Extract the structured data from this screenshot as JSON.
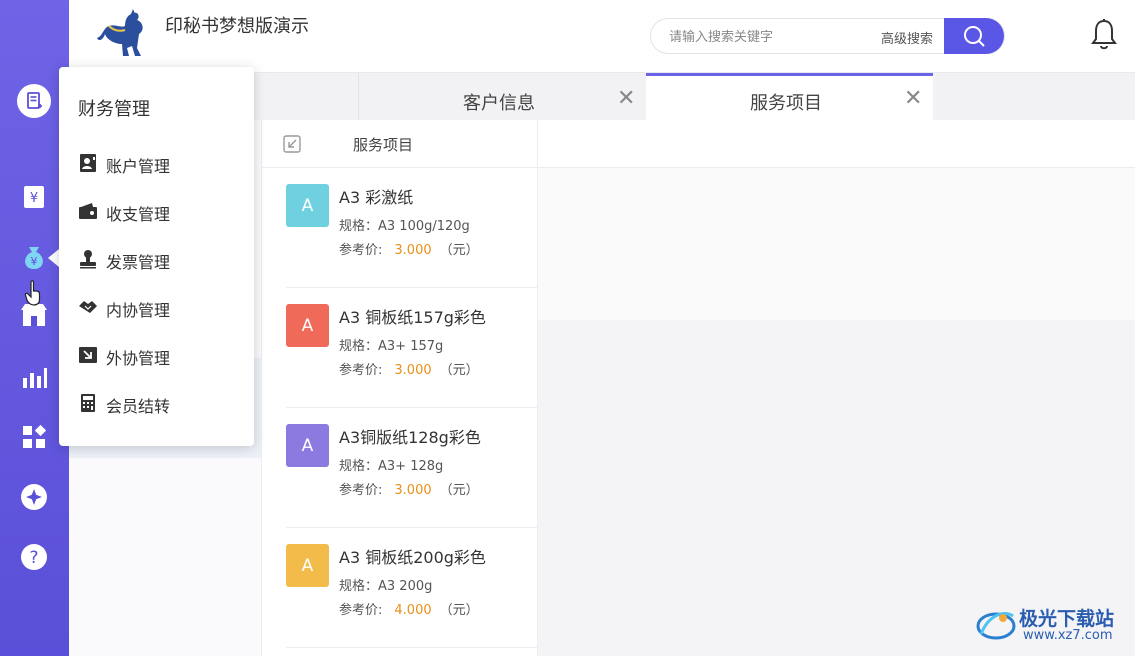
{
  "app": {
    "title": "印秘书梦想版演示"
  },
  "search": {
    "placeholder": "请输入搜索关键字",
    "advanced_label": "高级搜索"
  },
  "tabs": [
    {
      "label": "客户信息",
      "active": false
    },
    {
      "label": "服务项目",
      "active": true
    }
  ],
  "panel": {
    "title": "服务项目"
  },
  "services": [
    {
      "avatar": "A",
      "color": "#6fd0e0",
      "name": "A3 彩激纸",
      "spec": "规格：A3 100g/120g",
      "price_label": "参考价:",
      "price": "3.000",
      "unit": "（元）"
    },
    {
      "avatar": "A",
      "color": "#f06a5a",
      "name": "A3 铜板纸157g彩色",
      "spec": "规格：A3+ 157g",
      "price_label": "参考价:",
      "price": "3.000",
      "unit": "（元）"
    },
    {
      "avatar": "A",
      "color": "#8c7ae0",
      "name": "A3铜版纸128g彩色",
      "spec": "规格：A3+ 128g",
      "price_label": "参考价:",
      "price": "3.000",
      "unit": "（元）"
    },
    {
      "avatar": "A",
      "color": "#f2bb4a",
      "name": "A3 铜板纸200g彩色",
      "spec": "规格：A3 200g",
      "price_label": "参考价:",
      "price": "4.000",
      "unit": "（元）"
    }
  ],
  "menu": {
    "title": "财务管理",
    "items": [
      {
        "label": "账户管理",
        "icon": "account-icon"
      },
      {
        "label": "收支管理",
        "icon": "wallet-icon"
      },
      {
        "label": "发票管理",
        "icon": "stamp-icon"
      },
      {
        "label": "内协管理",
        "icon": "handshake-icon"
      },
      {
        "label": "外协管理",
        "icon": "export-icon"
      },
      {
        "label": "会员结转",
        "icon": "calculator-icon"
      }
    ]
  },
  "rail": {
    "icons": [
      "new-order-icon",
      "yen-doc-icon",
      "money-bag-icon",
      "store-icon",
      "bar-chart-icon",
      "apps-icon",
      "compass-icon",
      "help-icon"
    ],
    "accent": "#5a4fd8"
  },
  "watermark": {
    "title": "极光下载站",
    "url": "www.xz7.com"
  },
  "colors": {
    "primary": "#5a56e6",
    "price": "#e8901a"
  }
}
